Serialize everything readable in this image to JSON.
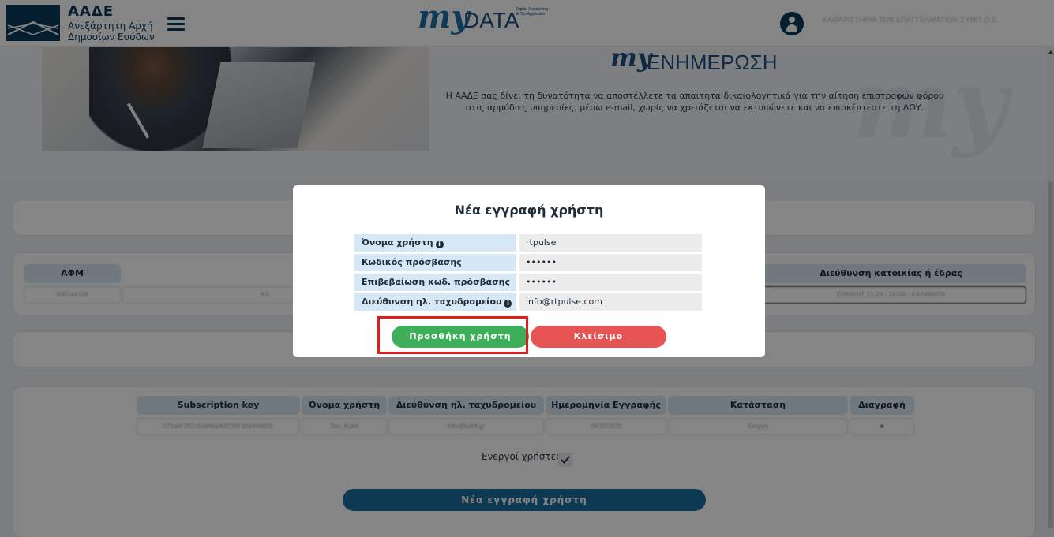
{
  "header": {
    "org_name": "ΑΑΔΕ",
    "org_subtitle": "Ανεξάρτητη Αρχή Δημοσίων Εσόδων",
    "app_logo_prefix": "my",
    "app_logo_name": "DATA",
    "app_logo_tagline": "Digital Accounting & Tax Application",
    "company_name": "ΚΑΘΑΡΙΣΤΗΡΙΑ ΤΩΝ ΕΠΑΓΓΕΛΜΑΤΙΩΝ ΣΥΜΠ Ο.Ε."
  },
  "hero": {
    "title_prefix": "my",
    "title": "ΕΝΗΜΕΡΩΣΗ",
    "description": "Η ΑΑΔΕ σας δίνει τη δυνατότητα να αποστέλλετε τα απαιτητα δικαιολογητικά για την αίτηση επιστροφών φόρου στις αρμόδιες υπηρεσίες, μέσω e-mail, χωρίς να χρειάζεται να εκτυπώνετε και να επισκέπτεστε τη ΔΟΥ.",
    "watermark": "my"
  },
  "taxpayer_table": {
    "headers": [
      "ΑΦΜ",
      "",
      "Διεύθυνση κατοικίας ή έδρας"
    ],
    "row": [
      "800744328",
      "ΚΑ",
      "ΕΘΝΙΚΗΣ 21-23 - 24100 - ΚΑΛΑΜΑΤΑ"
    ]
  },
  "users_table": {
    "headers": [
      "Subscription key",
      "Όνομα χρήστη",
      "Διεύθυνση ηλ. ταχυδρομείου",
      "Ημερομηνία Εγγραφής",
      "Κατάσταση",
      "Διαγραφή"
    ],
    "rows": [
      [
        "071a8f7f91c5ab6ba4d2289 b5b4e9d3c",
        "Tsio_Kubit",
        "info@kubit.gr",
        "09/10/2020",
        "Ενεργή",
        "■"
      ]
    ]
  },
  "filter": {
    "active_users_label": "Ενεργοί χρήστες",
    "active_users_checked": true
  },
  "bottom_button": {
    "label": "Νέα εγγραφή χρήστη"
  },
  "modal": {
    "title": "Νέα εγγραφή χρήστη",
    "fields": [
      {
        "label": "Όνομα χρήστη",
        "info": true,
        "value": "rtpulse"
      },
      {
        "label": "Κωδικός πρόσβασης",
        "info": false,
        "value": "••••••"
      },
      {
        "label": "Επιβεβαίωση κωδ. πρόσβασης",
        "info": false,
        "value": "••••••"
      },
      {
        "label": "Διεύθυνση ηλ. ταχυδρομείου",
        "info": true,
        "value": "info@rtpulse.com"
      }
    ],
    "add_button": "Προσθήκη χρήστη",
    "close_button": "Κλείσιμο",
    "info_icon_glyph": "i"
  },
  "colors": {
    "brand_dark": "#0b3a5a",
    "primary_button": "#1c6e9e",
    "add_button": "#3fae5a",
    "close_button": "#e65454",
    "highlight": "#e31c1c"
  }
}
